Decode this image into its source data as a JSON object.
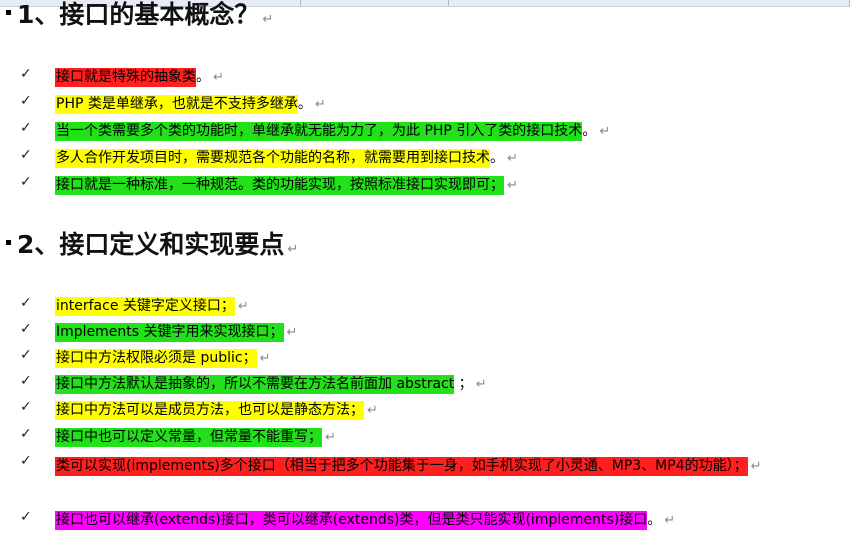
{
  "section1": {
    "title": "1、接口的基本概念？",
    "items": [
      {
        "text": "接口就是特殊的抽象类",
        "suffix": "。"
      },
      {
        "text": "PHP 类是单继承，也就是不支持多继承",
        "suffix": "。"
      },
      {
        "text": "当一个类需要多个类的功能时，单继承就无能为力了，为此 PHP 引入了类的接口技术",
        "suffix": "。"
      },
      {
        "text": "多人合作开发项目时，需要规范各个功能的名称，就需要用到接口技术",
        "suffix": "。"
      },
      {
        "text": "接口就是一种标准，一种规范。类的功能实现，按照标准接口实现即可；",
        "suffix": ""
      }
    ]
  },
  "section2": {
    "title": "2、接口定义和实现要点",
    "items": [
      {
        "text": "interface 关键字定义接口；",
        "suffix": ""
      },
      {
        "text": "Implements 关键字用来实现接口；",
        "suffix": ""
      },
      {
        "text": "接口中方法权限必须是 public；",
        "suffix": ""
      },
      {
        "text": "接口中方法默认是抽象的，所以不需要在方法名前面加 abstract",
        "suffix": " ；"
      },
      {
        "text": "接口中方法可以是成员方法，也可以是静态方法；",
        "suffix": ""
      },
      {
        "text": "接口中也可以定义常量，但常量不能重写；",
        "suffix": ""
      },
      {
        "text": "类可以实现(implements)多个接口（相当于把多个功能集于一身，如手机实现了小灵通、MP3、MP4的功能）；",
        "suffix": ""
      },
      {
        "text": "接口也可以继承(extends)接口，类可以继承(extends)类，但是类只能实现(implements)接口",
        "suffix": "。"
      }
    ]
  },
  "symbols": {
    "check": "✓",
    "paragraph_mark": "↵"
  },
  "colors": {
    "red": "#ff1f1f",
    "yellow": "#ffff00",
    "green": "#22e01a",
    "magenta": "#ff00ff"
  }
}
